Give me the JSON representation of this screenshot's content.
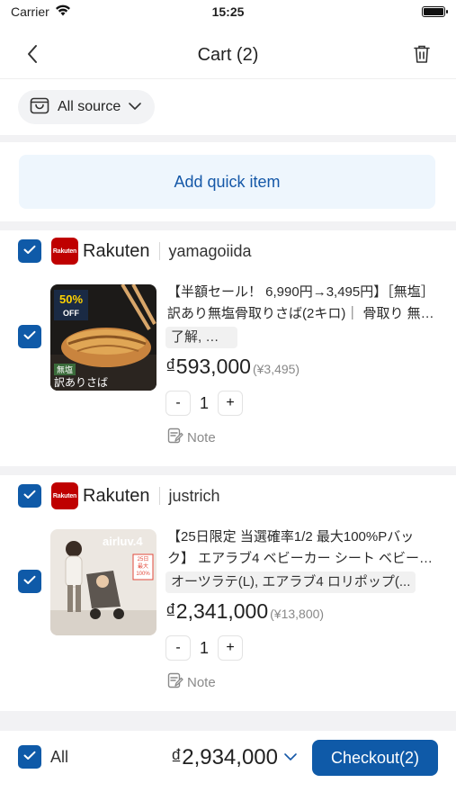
{
  "status_bar": {
    "carrier": "Carrier",
    "time": "15:25"
  },
  "header": {
    "title": "Cart (2)"
  },
  "filter": {
    "source_label": "All source"
  },
  "quick_item": {
    "label": "Add quick item"
  },
  "stores": [
    {
      "platform_logo_text": "Rakuten",
      "platform": "Rakuten",
      "seller": "yamagoiida",
      "item": {
        "title": "【半額セール！ 6,990円→3,495円】［無塩］訳あり無塩骨取りさば(2キロ)｜ 骨取り 無塩 さば",
        "variant": "了解, 了解",
        "price": "₫593,000",
        "original_price": "(¥3,495)",
        "quantity": "1",
        "note_label": "Note",
        "thumb_badge": "50%",
        "thumb_badge_sub": "OFF",
        "thumb_caption": "訳ありさば",
        "thumb_tag": "無塩"
      }
    },
    {
      "platform_logo_text": "Rakuten",
      "platform": "Rakuten",
      "seller": "justrich",
      "item": {
        "title": "【25日限定 当選確率1/2 最大100%Pバック】 エアラブ4 ベビーカー シート ベビーカー",
        "variant": "オーツラテ(L), エアラブ4 ロリポップ(...",
        "price": "₫2,341,000",
        "original_price": "(¥13,800)",
        "quantity": "1",
        "note_label": "Note",
        "thumb_brand": "airluv.4",
        "thumb_badge": "25日",
        "thumb_badge_sub": "最大100%"
      }
    }
  ],
  "footer": {
    "select_all_label": "All",
    "total": "₫2,934,000",
    "checkout_label": "Checkout(2)"
  },
  "colors": {
    "primary": "#0f5aa8",
    "rakuten": "#bf0000",
    "quick_bg": "#eef6fd"
  }
}
